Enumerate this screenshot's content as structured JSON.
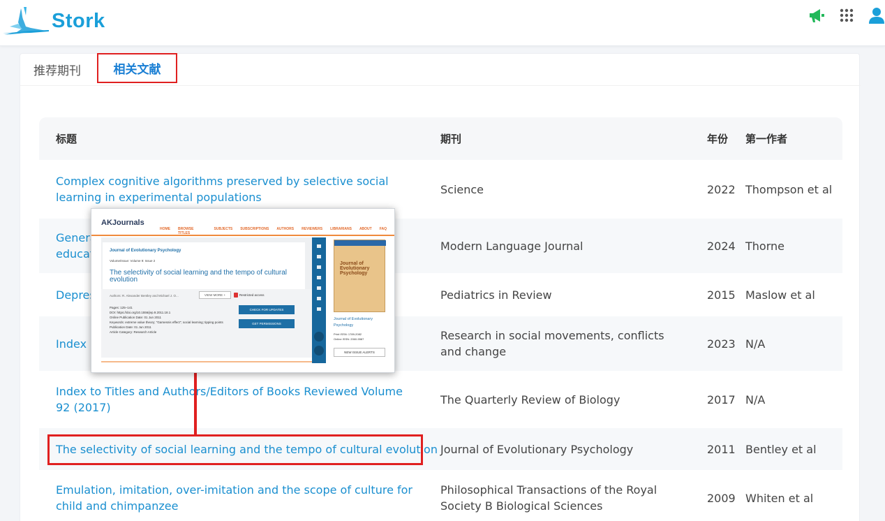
{
  "app": {
    "name": "Stork"
  },
  "colors": {
    "brand": "#1a9fd9",
    "link": "#1a8fd0",
    "highlight": "#e02020",
    "megaphone": "#22b85a"
  },
  "header": {
    "icons": [
      "megaphone-icon",
      "apps-grid-icon",
      "user-icon"
    ]
  },
  "tabs": [
    {
      "label": "推荐期刊",
      "active": false
    },
    {
      "label": "相关文献",
      "active": true
    }
  ],
  "table": {
    "headers": {
      "title": "标题",
      "journal": "期刊",
      "year": "年份",
      "author": "第一作者"
    },
    "rows": [
      {
        "title": "Complex cognitive algorithms preserved by selective social learning in experimental populations",
        "journal": "Science",
        "year": "2022",
        "author": "Thompson et al"
      },
      {
        "title": "Genera",
        "title_line2": "educat",
        "journal": "Modern Language Journal",
        "year": "2024",
        "author": "Thorne"
      },
      {
        "title": "Depres",
        "journal": "Pediatrics in Review",
        "year": "2015",
        "author": "Maslow et al"
      },
      {
        "title": "Index",
        "journal": "Research in social movements, conflicts and change",
        "year": "2023",
        "author": "N/A"
      },
      {
        "title": "Index to Titles and Authors/Editors of Books Reviewed Volume 92 (2017)",
        "journal": "The Quarterly Review of Biology",
        "year": "2017",
        "author": "N/A"
      },
      {
        "title": "The selectivity of social learning and the tempo of cultural evolution",
        "journal": "Journal of Evolutionary Psychology",
        "year": "2011",
        "author": "Bentley et al"
      },
      {
        "title": "Emulation, imitation, over-imitation and the scope of culture for child and chimpanzee",
        "journal": "Philosophical Transactions of the Royal Society B Biological Sciences",
        "year": "2009",
        "author": "Whiten et al"
      }
    ]
  },
  "preview": {
    "brand": "AKJournals",
    "nav": [
      "HOME",
      "BROWSE TITLES",
      "SUBJECTS",
      "SUBSCRIPTIONS",
      "AUTHORS",
      "REVIEWERS",
      "LIBRARIANS",
      "ABOUT",
      "FAQ"
    ],
    "journal": "Journal of Evolutionary Psychology",
    "volume": "Volume/Issue: Volume 9: Issue 2",
    "title": "The selectivity of social learning and the tempo of cultural evolution",
    "authors": "Authors: R. Alexander Bentley and Michael J. O...",
    "view_more": "VIEW MORE +",
    "restricted": "Restricted access",
    "meta_pages": "Pages: 125–141",
    "meta_doi": "DOI: https://doi.org/10.1556/jep.9.2011.18.1",
    "meta_online": "Online Publication Date: 01 Jun 2011",
    "meta_keywords": "Keywords: extreme value theory; \"Gamesnis effect\"; social learning; tipping points",
    "meta_pubdate": "Publication Date: 01 Jun 2011",
    "meta_category": "Article Category: Research Article",
    "check_updates": "CHECK FOR UPDATES",
    "get_permissions": "GET PERMISSIONS",
    "cover_title": "Journal of Evolutionary Psychology",
    "cover_journal": "Journal of Evolutionary Psychology",
    "print_issn": "Print ISSN: 1789-2082",
    "online_issn": "Online ISSN: 2060-5587",
    "alerts": "NEW ISSUE ALERTS"
  }
}
